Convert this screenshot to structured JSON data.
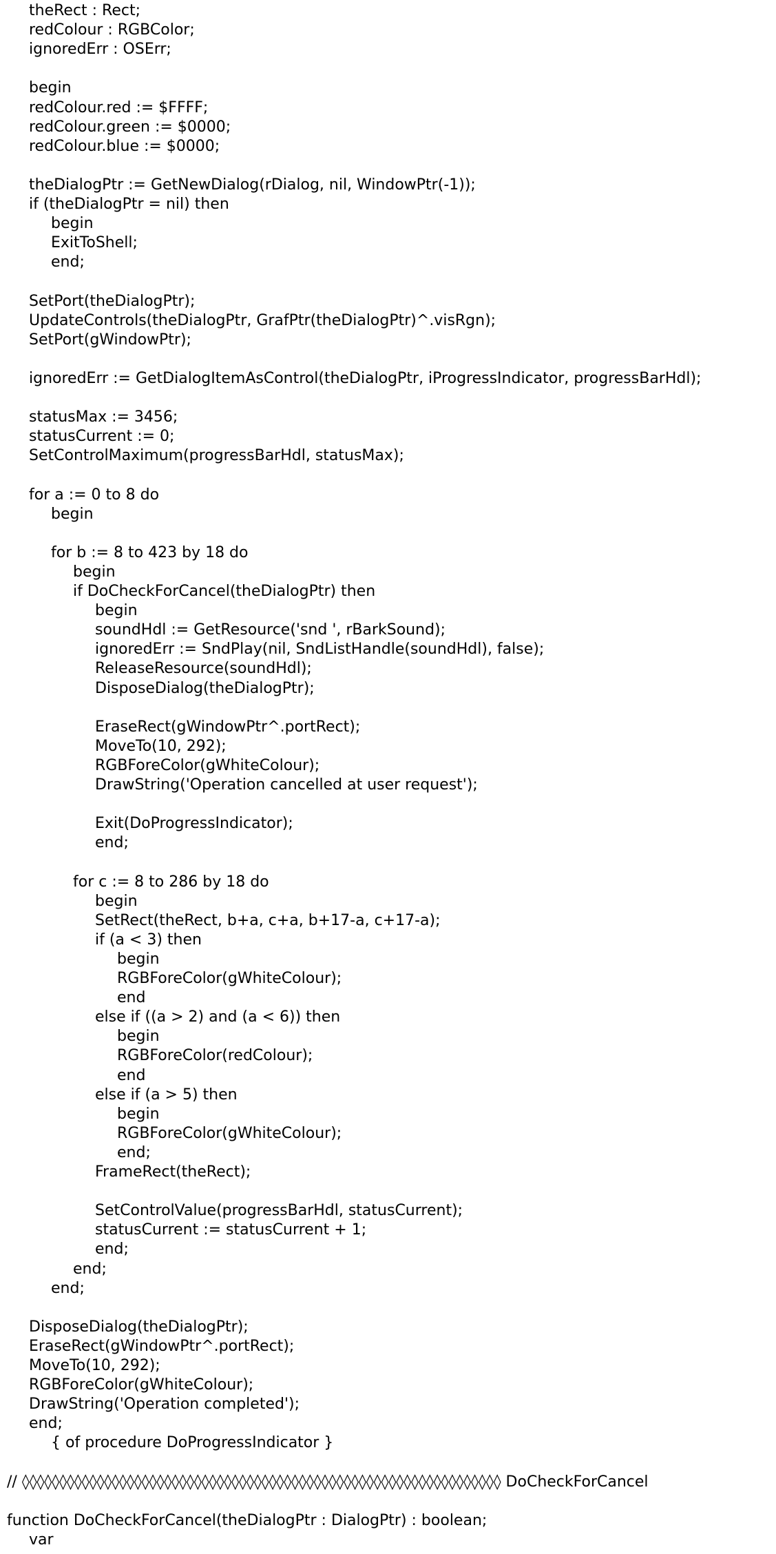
{
  "document": {
    "lines": [
      {
        "indent": 1,
        "text": "theRect : Rect;"
      },
      {
        "indent": 1,
        "text": "redColour : RGBColor;"
      },
      {
        "indent": 1,
        "text": "ignoredErr : OSErr;"
      },
      {
        "indent": 0,
        "text": ""
      },
      {
        "indent": 1,
        "text": "begin"
      },
      {
        "indent": 1,
        "text": "redColour.red := $FFFF;"
      },
      {
        "indent": 1,
        "text": "redColour.green := $0000;"
      },
      {
        "indent": 1,
        "text": "redColour.blue := $0000;"
      },
      {
        "indent": 0,
        "text": ""
      },
      {
        "indent": 1,
        "text": "theDialogPtr := GetNewDialog(rDialog, nil, WindowPtr(-1));"
      },
      {
        "indent": 1,
        "text": "if (theDialogPtr = nil) then"
      },
      {
        "indent": 2,
        "text": "begin"
      },
      {
        "indent": 2,
        "text": "ExitToShell;"
      },
      {
        "indent": 2,
        "text": "end;"
      },
      {
        "indent": 0,
        "text": ""
      },
      {
        "indent": 1,
        "text": "SetPort(theDialogPtr);"
      },
      {
        "indent": 1,
        "text": "UpdateControls(theDialogPtr, GrafPtr(theDialogPtr)^.visRgn);"
      },
      {
        "indent": 1,
        "text": "SetPort(gWindowPtr);"
      },
      {
        "indent": 0,
        "text": ""
      },
      {
        "indent": 1,
        "text": "ignoredErr := GetDialogItemAsControl(theDialogPtr, iProgressIndicator, progressBarHdl);"
      },
      {
        "indent": 0,
        "text": ""
      },
      {
        "indent": 1,
        "text": "statusMax := 3456;"
      },
      {
        "indent": 1,
        "text": "statusCurrent := 0;"
      },
      {
        "indent": 1,
        "text": "SetControlMaximum(progressBarHdl, statusMax);"
      },
      {
        "indent": 0,
        "text": ""
      },
      {
        "indent": 1,
        "text": "for a := 0 to 8 do"
      },
      {
        "indent": 2,
        "text": "begin"
      },
      {
        "indent": 0,
        "text": ""
      },
      {
        "indent": 2,
        "text": "for b := 8 to 423 by 18 do"
      },
      {
        "indent": 3,
        "text": "begin"
      },
      {
        "indent": 3,
        "text": "if DoCheckForCancel(theDialogPtr) then"
      },
      {
        "indent": 4,
        "text": "begin"
      },
      {
        "indent": 4,
        "text": "soundHdl := GetResource('snd ', rBarkSound);"
      },
      {
        "indent": 4,
        "text": "ignoredErr := SndPlay(nil, SndListHandle(soundHdl), false);"
      },
      {
        "indent": 4,
        "text": "ReleaseResource(soundHdl);"
      },
      {
        "indent": 4,
        "text": "DisposeDialog(theDialogPtr);"
      },
      {
        "indent": 0,
        "text": ""
      },
      {
        "indent": 4,
        "text": "EraseRect(gWindowPtr^.portRect);"
      },
      {
        "indent": 4,
        "text": "MoveTo(10, 292);"
      },
      {
        "indent": 4,
        "text": "RGBForeColor(gWhiteColour);"
      },
      {
        "indent": 4,
        "text": "DrawString('Operation cancelled at user request');"
      },
      {
        "indent": 0,
        "text": ""
      },
      {
        "indent": 4,
        "text": "Exit(DoProgressIndicator);"
      },
      {
        "indent": 4,
        "text": "end;"
      },
      {
        "indent": 0,
        "text": ""
      },
      {
        "indent": 3,
        "text": "for c := 8 to 286 by 18 do"
      },
      {
        "indent": 4,
        "text": "begin"
      },
      {
        "indent": 4,
        "text": "SetRect(theRect, b+a, c+a, b+17-a, c+17-a);"
      },
      {
        "indent": 4,
        "text": "if (a < 3) then"
      },
      {
        "indent": 5,
        "text": "begin"
      },
      {
        "indent": 5,
        "text": "RGBForeColor(gWhiteColour);"
      },
      {
        "indent": 5,
        "text": "end"
      },
      {
        "indent": 4,
        "text": "else if ((a > 2) and (a < 6)) then"
      },
      {
        "indent": 5,
        "text": "begin"
      },
      {
        "indent": 5,
        "text": "RGBForeColor(redColour);"
      },
      {
        "indent": 5,
        "text": "end"
      },
      {
        "indent": 4,
        "text": "else if (a > 5) then"
      },
      {
        "indent": 5,
        "text": "begin"
      },
      {
        "indent": 5,
        "text": "RGBForeColor(gWhiteColour);"
      },
      {
        "indent": 5,
        "text": "end;"
      },
      {
        "indent": 4,
        "text": "FrameRect(theRect);"
      },
      {
        "indent": 0,
        "text": ""
      },
      {
        "indent": 4,
        "text": "SetControlValue(progressBarHdl, statusCurrent);"
      },
      {
        "indent": 4,
        "text": "statusCurrent := statusCurrent + 1;"
      },
      {
        "indent": 4,
        "text": "end;"
      },
      {
        "indent": 3,
        "text": "end;"
      },
      {
        "indent": 2,
        "text": "end;"
      },
      {
        "indent": 0,
        "text": ""
      },
      {
        "indent": 1,
        "text": "DisposeDialog(theDialogPtr);"
      },
      {
        "indent": 1,
        "text": "EraseRect(gWindowPtr^.portRect);"
      },
      {
        "indent": 1,
        "text": "MoveTo(10, 292);"
      },
      {
        "indent": 1,
        "text": "RGBForeColor(gWhiteColour);"
      },
      {
        "indent": 1,
        "text": "DrawString('Operation completed');"
      },
      {
        "indent": 1,
        "text": "end;"
      },
      {
        "indent": 2,
        "text": "{ of procedure DoProgressIndicator }"
      },
      {
        "indent": 0,
        "text": ""
      },
      {
        "indent": 0,
        "text": "// ◊◊◊◊◊◊◊◊◊◊◊◊◊◊◊◊◊◊◊◊◊◊◊◊◊◊◊◊◊◊◊◊◊◊◊◊◊◊◊◊◊◊◊◊◊◊◊◊◊◊◊◊◊◊◊◊◊◊◊◊◊◊◊◊ DoCheckForCancel"
      },
      {
        "indent": 0,
        "text": ""
      },
      {
        "indent": 0,
        "text": "function DoCheckForCancel(theDialogPtr : DialogPtr) : boolean;"
      },
      {
        "indent": 1,
        "text": "var"
      }
    ]
  }
}
